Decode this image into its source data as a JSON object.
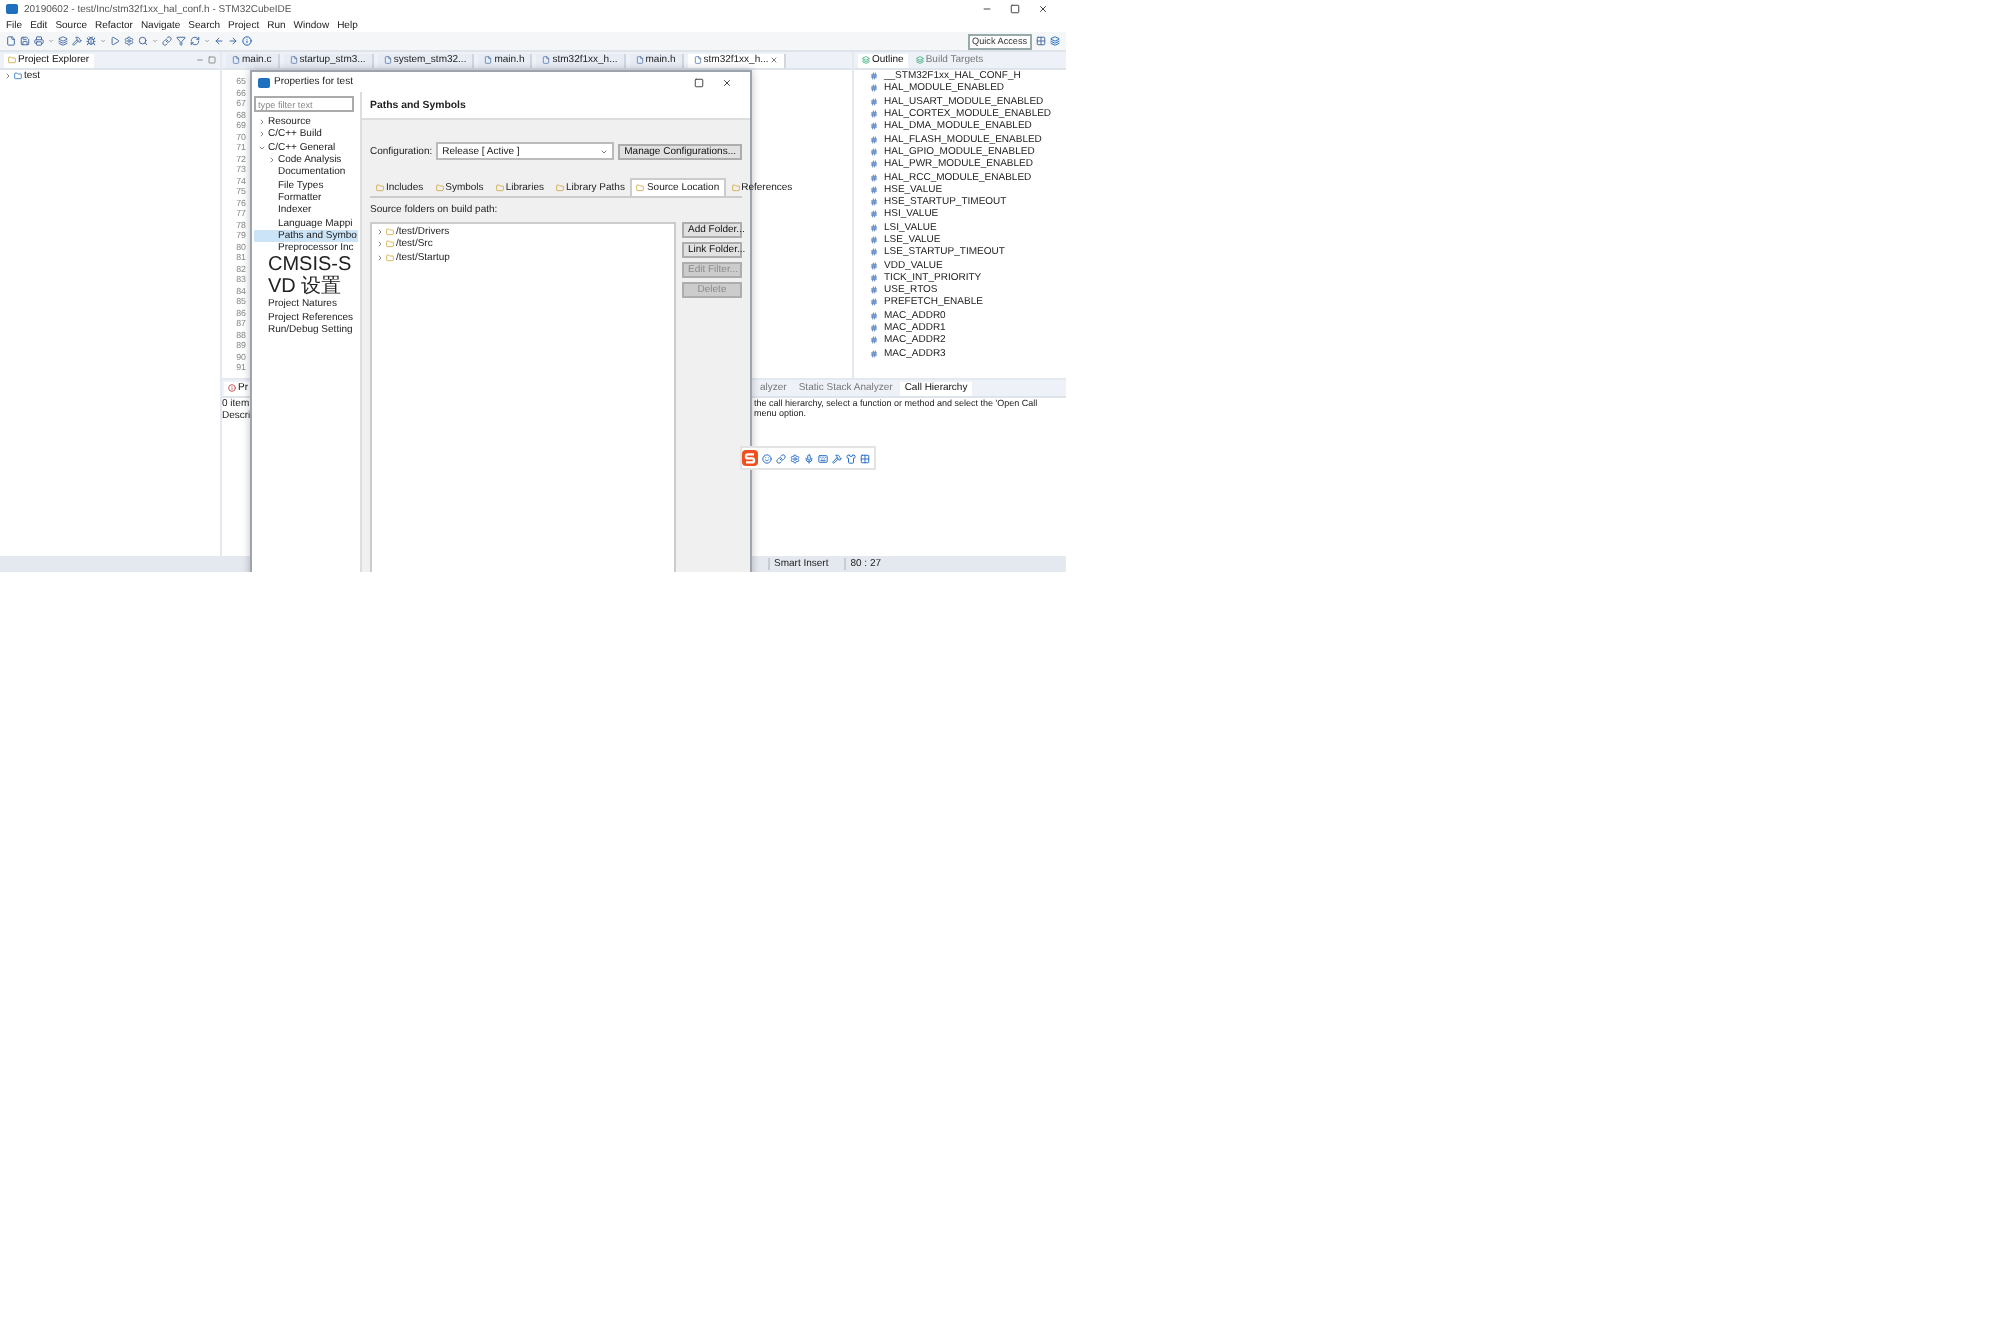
{
  "window": {
    "title": "20190602 - test/Inc/stm32f1xx_hal_conf.h - STM32CubeIDE"
  },
  "menu": [
    "File",
    "Edit",
    "Source",
    "Refactor",
    "Navigate",
    "Search",
    "Project",
    "Run",
    "Window",
    "Help"
  ],
  "toolbar": {
    "quick_access": {
      "placeholder": "Quick Access"
    }
  },
  "project_explorer": {
    "title": "Project Explorer",
    "items": [
      {
        "label": "test",
        "expanded": false
      }
    ]
  },
  "editor": {
    "tabs": [
      {
        "label": "main.c",
        "selected": false
      },
      {
        "label": "startup_stm3...",
        "selected": false
      },
      {
        "label": "system_stm32...",
        "selected": false
      },
      {
        "label": "main.h",
        "selected": false
      },
      {
        "label": "stm32f1xx_h...",
        "selected": false
      },
      {
        "label": "main.h",
        "selected": false
      },
      {
        "label": "stm32f1xx_h...",
        "selected": true
      }
    ],
    "line_numbers": [
      "65",
      "66",
      "67",
      "68",
      "69",
      "70",
      "71",
      "72",
      "73",
      "74",
      "75",
      "76",
      "77",
      "78",
      "79",
      "80",
      "81",
      "82",
      "83",
      "84",
      "85",
      "86",
      "87",
      "88",
      "89",
      "90",
      "91"
    ]
  },
  "problems": {
    "tab": "Pr",
    "count": "0 item",
    "column_1": "Descri"
  },
  "outline": {
    "tabs": [
      {
        "label": "Outline",
        "selected": true
      },
      {
        "label": "Build Targets",
        "selected": false
      }
    ],
    "items": [
      "__STM32F1xx_HAL_CONF_H",
      "HAL_MODULE_ENABLED",
      "HAL_USART_MODULE_ENABLED",
      "HAL_CORTEX_MODULE_ENABLED",
      "HAL_DMA_MODULE_ENABLED",
      "HAL_FLASH_MODULE_ENABLED",
      "HAL_GPIO_MODULE_ENABLED",
      "HAL_PWR_MODULE_ENABLED",
      "HAL_RCC_MODULE_ENABLED",
      "HSE_VALUE",
      "HSE_STARTUP_TIMEOUT",
      "HSI_VALUE",
      "LSI_VALUE",
      "LSE_VALUE",
      "LSE_STARTUP_TIMEOUT",
      "VDD_VALUE",
      "TICK_INT_PRIORITY",
      "USE_RTOS",
      "PREFETCH_ENABLE",
      "MAC_ADDR0",
      "MAC_ADDR1",
      "MAC_ADDR2",
      "MAC_ADDR3"
    ]
  },
  "call_hierarchy": {
    "tabs": [
      {
        "label": "alyzer",
        "selected": false
      },
      {
        "label": "Static Stack Analyzer",
        "selected": false
      },
      {
        "label": "Call Hierarchy",
        "selected": true
      }
    ],
    "message": [
      "the call hierarchy, select a function or method and select the 'Open Call",
      "menu option."
    ]
  },
  "status_bar": [
    "Smart Insert",
    "80 : 27"
  ],
  "dialog": {
    "title": "Properties for test",
    "filter": {
      "placeholder": "type filter text"
    },
    "tree": [
      {
        "label": "Resource",
        "expanded": false,
        "selected": false
      },
      {
        "label": "C/C++ Build",
        "expanded": false,
        "selected": false
      },
      {
        "label": "C/C++ General",
        "expanded": true,
        "selected": false,
        "children": [
          {
            "label": "Code Analysis",
            "expanded": false,
            "selected": false
          },
          {
            "label": "Documentation",
            "selected": false
          },
          {
            "label": "File Types",
            "selected": false
          },
          {
            "label": "Formatter",
            "selected": false
          },
          {
            "label": "Indexer",
            "selected": false
          },
          {
            "label": "Language Mappi",
            "selected": false
          },
          {
            "label": "Paths and Symbo",
            "selected": true
          },
          {
            "label": "Preprocessor Inc",
            "selected": false
          }
        ]
      },
      {
        "label": "CMSIS-SVD 设置",
        "selected": false
      },
      {
        "label": "Project Natures",
        "selected": false
      },
      {
        "label": "Project References",
        "selected": false
      },
      {
        "label": "Run/Debug Setting",
        "selected": false
      }
    ],
    "page_title": "Paths and Symbols",
    "configuration": {
      "label": "Configuration:",
      "value": "Release  [ Active ]",
      "button": "Manage Configurations..."
    },
    "tabs": [
      {
        "label": "Includes",
        "selected": false
      },
      {
        "label": "Symbols",
        "selected": false
      },
      {
        "label": "Libraries",
        "selected": false
      },
      {
        "label": "Library Paths",
        "selected": false
      },
      {
        "label": "Source Location",
        "selected": true
      },
      {
        "label": "References",
        "selected": false
      }
    ],
    "list_label": "Source folders on build path:",
    "folders": [
      {
        "label": "/test/Drivers",
        "expanded": false
      },
      {
        "label": "/test/Src",
        "expanded": false
      },
      {
        "label": "/test/Startup",
        "expanded": false
      }
    ],
    "buttons": [
      {
        "label": "Add Folder...",
        "disabled": false
      },
      {
        "label": "Link Folder...",
        "disabled": false
      },
      {
        "label": "Edit Filter...",
        "disabled": true
      },
      {
        "label": "Delete",
        "disabled": true
      }
    ]
  }
}
